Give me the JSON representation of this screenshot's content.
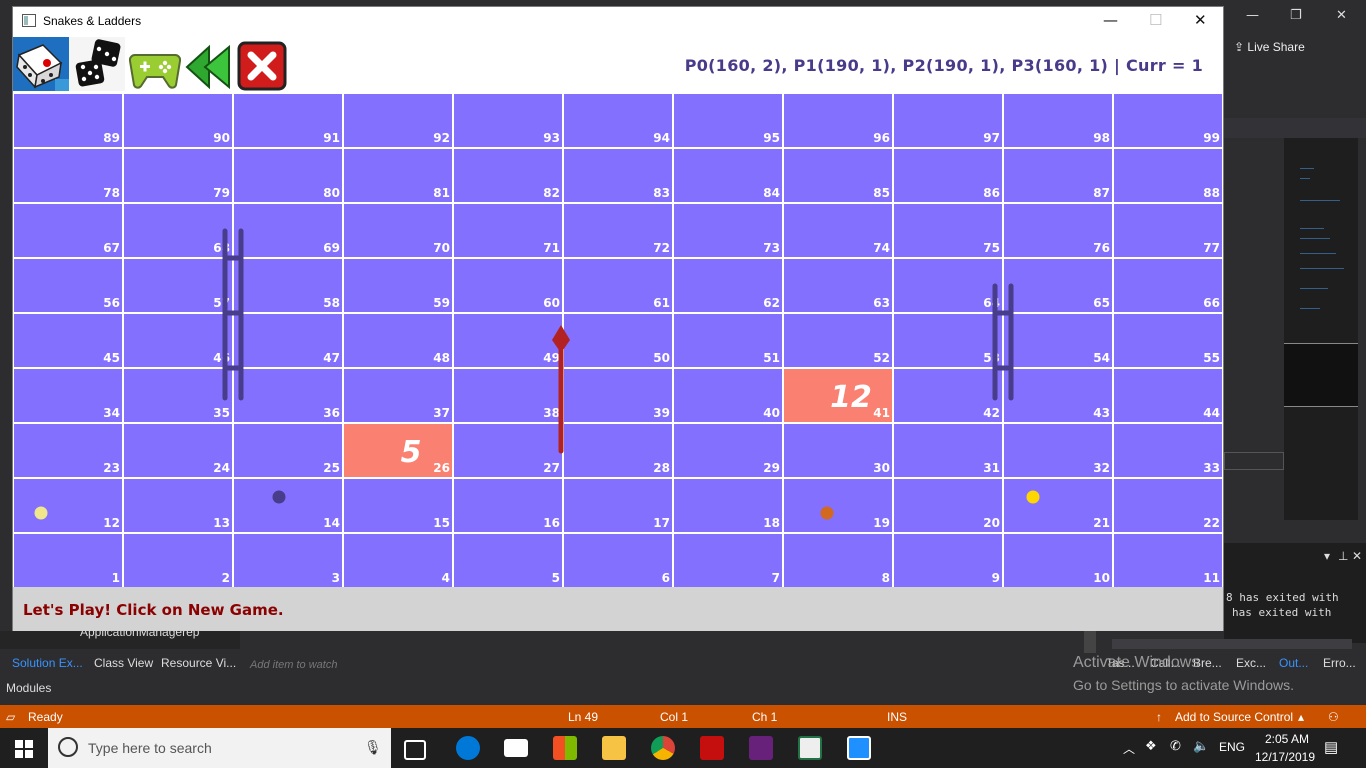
{
  "window": {
    "title": "Snakes & Ladders",
    "minimize": "—",
    "maximize": "☐",
    "close": "✕"
  },
  "toolbar": {
    "buttons": [
      {
        "icon": "dice-board-icon"
      },
      {
        "icon": "dice-pair-icon"
      },
      {
        "icon": "gamepad-icon"
      },
      {
        "icon": "rewind-icon"
      },
      {
        "icon": "close-x-icon"
      }
    ],
    "status": "P0(160, 2), P1(190, 1), P2(190, 1), P3(160, 1) | Curr = 1"
  },
  "board": {
    "rows": [
      [
        89,
        90,
        91,
        92,
        93,
        94,
        95,
        96,
        97,
        98,
        99
      ],
      [
        78,
        79,
        80,
        81,
        82,
        83,
        84,
        85,
        86,
        87,
        88
      ],
      [
        67,
        68,
        69,
        70,
        71,
        72,
        73,
        74,
        75,
        76,
        77
      ],
      [
        56,
        57,
        58,
        59,
        60,
        61,
        62,
        63,
        64,
        65,
        66
      ],
      [
        45,
        46,
        47,
        48,
        49,
        50,
        51,
        52,
        53,
        54,
        55
      ],
      [
        34,
        35,
        36,
        37,
        38,
        39,
        40,
        41,
        42,
        43,
        44
      ],
      [
        23,
        24,
        25,
        26,
        27,
        28,
        29,
        30,
        31,
        32,
        33
      ],
      [
        12,
        13,
        14,
        15,
        16,
        17,
        18,
        19,
        20,
        21,
        22
      ],
      [
        1,
        2,
        3,
        4,
        5,
        6,
        7,
        8,
        9,
        10,
        11
      ]
    ],
    "highlights": [
      {
        "cell": 26,
        "value": "5"
      },
      {
        "cell": 41,
        "value": "12"
      }
    ],
    "ladders": [
      {
        "from": 36,
        "to": 69
      },
      {
        "from": 43,
        "to": 65
      }
    ],
    "snakes": [
      {
        "head": 49,
        "tail": 27
      }
    ],
    "players": [
      {
        "cell": 12,
        "color": "#f0e68c"
      },
      {
        "cell": 14,
        "color": "#483d8b"
      },
      {
        "cell": 19,
        "color": "#d2691e"
      },
      {
        "cell": 21,
        "color": "#ffd700"
      }
    ],
    "colors": {
      "cell": "#8470ff",
      "grid": "#ffffff",
      "highlight": "#fa8072",
      "ladder": "#483d8b",
      "snake": "#b22222"
    }
  },
  "message": "Let's Play! Click on New Game.",
  "ide": {
    "live_share": "Live Share",
    "output_lines": [
      "8 has exited with",
      "has exited with"
    ],
    "panel_tabs": [
      "Solution Ex...",
      "Class View",
      "Resource Vi..."
    ],
    "watch_placeholder": "Add item to watch",
    "output_tabs": [
      "Tas...",
      "Call...",
      "Bre...",
      "Exc...",
      "Out...",
      "Erro..."
    ],
    "modules": "Modules",
    "tree_item": "ApplicationManagerep",
    "status": {
      "ready": "Ready",
      "ln": "Ln 49",
      "col": "Col 1",
      "ch": "Ch 1",
      "ins": "INS",
      "source_control": "Add to Source Control"
    },
    "watermark_title": "Activate Windows",
    "watermark_sub": "Go to Settings to activate Windows."
  },
  "taskbar": {
    "search_placeholder": "Type here to search",
    "lang": "ENG",
    "time": "2:05 AM",
    "date": "12/17/2019",
    "notification_count": "1"
  }
}
